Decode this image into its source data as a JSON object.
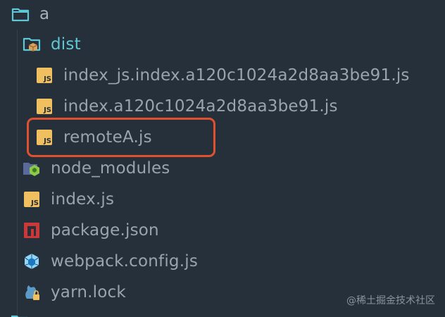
{
  "tree": {
    "root": {
      "label": "a",
      "icon": "folder-open-icon"
    },
    "dist": {
      "label": "dist",
      "icon": "folder-package-icon"
    },
    "dist_files": [
      {
        "label": "index_js.index.a120c1024a2d8aa3be91.js",
        "icon": "js-file-icon",
        "badge": "JS"
      },
      {
        "label": "index.a120c1024a2d8aa3be91.js",
        "icon": "js-file-icon",
        "badge": "JS"
      },
      {
        "label": "remoteA.js",
        "icon": "js-file-icon",
        "badge": "JS"
      }
    ],
    "root_files": [
      {
        "label": "node_modules",
        "icon": "node-modules-icon"
      },
      {
        "label": "index.js",
        "icon": "js-file-icon",
        "badge": "JS"
      },
      {
        "label": "package.json",
        "icon": "npm-package-icon"
      },
      {
        "label": "webpack.config.js",
        "icon": "webpack-icon"
      },
      {
        "label": "yarn.lock",
        "icon": "yarn-lock-icon"
      }
    ]
  },
  "watermark": "@稀土掘金技术社区",
  "colors": {
    "background": "#25303a",
    "text": "#9aa4ad",
    "accent": "#5ec8d6",
    "js_badge": "#f0c060",
    "highlight": "#e0512f"
  }
}
